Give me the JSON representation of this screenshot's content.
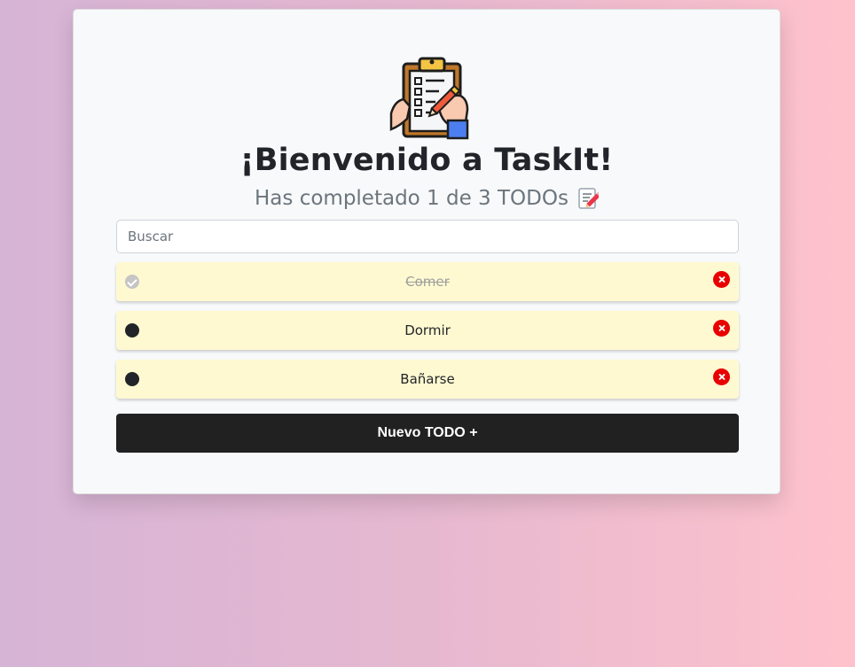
{
  "header": {
    "title": "¡Bienvenido a TaskIt!",
    "subtitle": "Has completado 1 de 3 TODOs",
    "logo_icon": "clipboard-checklist-icon",
    "subtitle_icon": "memo-icon"
  },
  "search": {
    "placeholder": "Buscar",
    "value": ""
  },
  "todos": [
    {
      "text": "Comer",
      "completed": true
    },
    {
      "text": "Dormir",
      "completed": false
    },
    {
      "text": "Bañarse",
      "completed": false
    }
  ],
  "actions": {
    "new_todo_label": "Nuevo TODO +"
  },
  "colors": {
    "todo_background": "#fff9d1",
    "delete_button": "#e80000",
    "primary_button": "#212121",
    "completed_check": "#c5c5c5"
  }
}
